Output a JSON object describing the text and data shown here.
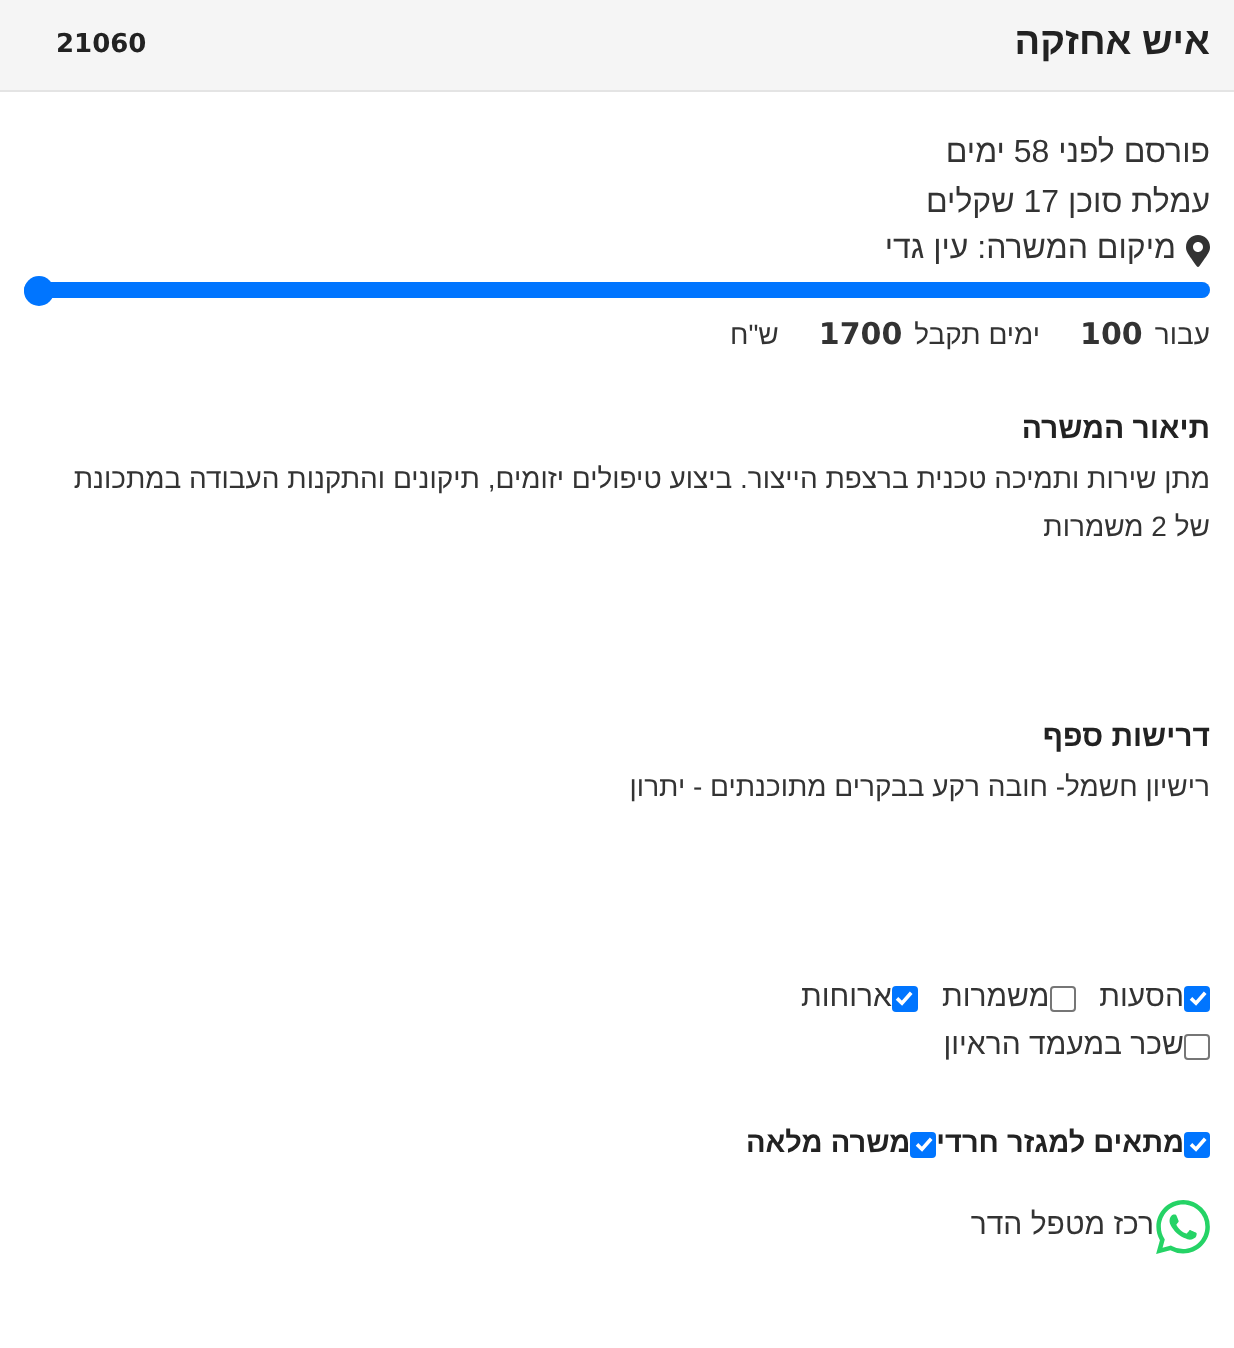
{
  "header": {
    "title": "איש אחזקה",
    "job_number": "21060"
  },
  "details": {
    "posted": "פורסם לפני 58 ימים",
    "commission": "עמלת סוכן 17 שקלים",
    "location": "מיקום המשרה: עין גדי"
  },
  "bonus_slider": {
    "level": 1
  },
  "bonus_summary": {
    "prefix": "עבור",
    "days": "100",
    "days_label": "ימים תקבל",
    "amount": "1700",
    "currency": "ש\"ח"
  },
  "sections": [
    {
      "heading": "תיאור המשרה",
      "body": "מתן שירות ותמיכה טכנית ברצפת הייצור. ביצוע טיפולים יזומים, תיקונים והתקנות העבודה במתכונת של 2 משמרות"
    },
    {
      "heading": "דרישות ספף",
      "body": "רישיון חשמל- חובה רקע בבקרים מתוכנתים - יתרון"
    }
  ],
  "benefit_rows": [
    [
      {
        "label": "הסעות",
        "checked": true
      },
      {
        "label": "משמרות",
        "checked": false
      },
      {
        "label": "ארוחות",
        "checked": true
      }
    ],
    [
      {
        "label": "שכר במעמד הראיון",
        "checked": false
      }
    ]
  ],
  "attributes": [
    {
      "label": "מתאים למגזר חרדי",
      "checked": true
    },
    {
      "label": "משרה מלאה",
      "checked": true
    }
  ],
  "contact": {
    "name": "רכז מטפל הדר"
  }
}
